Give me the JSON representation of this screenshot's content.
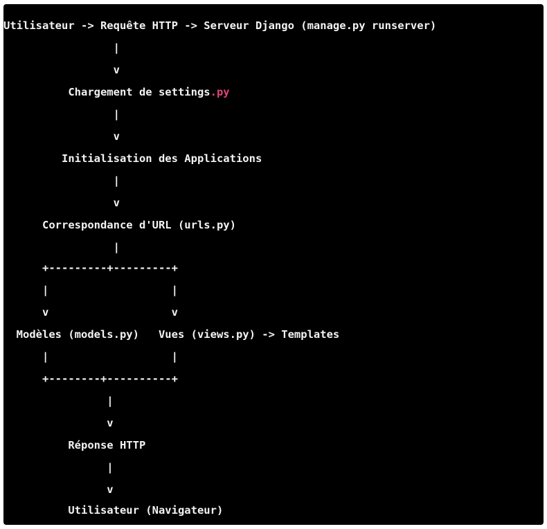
{
  "diagram": {
    "lines": [
      "Utilisateur -> Requête HTTP -> Serveur Django (manage.py runserver)",
      "                 |",
      "                 v",
      "          Chargement de settings",
      "                 |",
      "                 v",
      "         Initialisation des Applications",
      "                 |",
      "                 v",
      "      Correspondance d'URL (urls.py)",
      "                 |",
      "      +---------+---------+",
      "      |                   |",
      "      v                   v",
      "  Modèles (models.py)   Vues (views.py) -> Templates",
      "      |                   |",
      "      +--------+----------+",
      "                |",
      "                v",
      "          Réponse HTTP",
      "                |",
      "                v",
      "          Utilisateur (Navigateur)"
    ],
    "settings_ext": ".py",
    "accent_color": "#e0447a",
    "text_color": "#f3f3f3",
    "background_color": "#000000"
  }
}
